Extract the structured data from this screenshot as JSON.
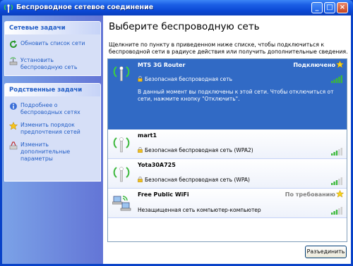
{
  "window": {
    "title": "Беспроводное сетевое соединение"
  },
  "sidebar": {
    "network_tasks": {
      "header": "Сетевые задачи",
      "items": [
        {
          "label": "Обновить список сети",
          "icon": "refresh-icon"
        },
        {
          "label": "Установить беспроводную сеть",
          "icon": "setup-wireless-icon"
        }
      ]
    },
    "related_tasks": {
      "header": "Родственные задачи",
      "items": [
        {
          "label": "Подробнее о беспроводных сетях",
          "icon": "info-icon"
        },
        {
          "label": "Изменить порядок предпочтения  сетей",
          "icon": "star-icon"
        },
        {
          "label": "Изменить дополнительные параметры",
          "icon": "settings-icon"
        }
      ]
    }
  },
  "main": {
    "heading": "Выберите беспроводную сеть",
    "description": "Щелкните по пункту в приведенном ниже списке, чтобы подключиться к беспроводной сети в радиусе действия или получить дополнительные сведения.",
    "networks": [
      {
        "name": "MTS 3G Router",
        "status": "Подключено",
        "security": "Безопасная беспроводная сеть",
        "info": "В данный момент вы подключены к этой сети. Чтобы отключиться от сети, нажмите кнопку \"Отключить\".",
        "signal_bars": 5,
        "preferred": true,
        "selected": true
      },
      {
        "name": "mart1",
        "status": "",
        "security": "Безопасная беспроводная сеть (WPA2)",
        "signal_bars": 3,
        "preferred": false,
        "selected": false
      },
      {
        "name": "Yota30A725",
        "status": "",
        "security": "Безопасная беспроводная сеть (WPA)",
        "signal_bars": 3,
        "preferred": false,
        "selected": false
      },
      {
        "name": "Free Public WiFi",
        "status": "По требованию",
        "security": "Незащищенная сеть компьютер-компьютер",
        "signal_bars": 3,
        "preferred": true,
        "selected": false
      }
    ],
    "disconnect_button": "Разъединить"
  },
  "colors": {
    "accent": "#0842c8",
    "selection": "#316ac5",
    "link": "#215dc6",
    "signal_green": "#3cb83c"
  }
}
